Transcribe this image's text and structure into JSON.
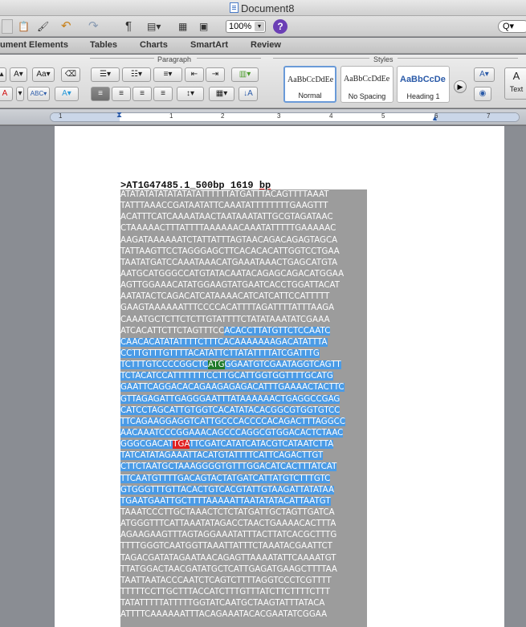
{
  "window": {
    "title": "Document8"
  },
  "toolbar": {
    "zoom_value": "100%",
    "help_label": "?",
    "search_placeholder": "Q▾"
  },
  "ribbon_tabs": [
    "ument Elements",
    "Tables",
    "Charts",
    "SmartArt",
    "Review"
  ],
  "ribbon_groups": {
    "paragraph": "Paragraph",
    "styles": "Styles"
  },
  "styles_gallery": [
    {
      "sample": "AaBbCcDdEe",
      "name": "Normal",
      "active": true
    },
    {
      "sample": "AaBbCcDdEe",
      "name": "No Spacing",
      "active": false
    },
    {
      "sample": "AaBbCcDe",
      "name": "Heading 1",
      "active": false
    }
  ],
  "text_box_label": "Text",
  "ruler_numbers": [
    "1",
    "1",
    "2",
    "3",
    "4",
    "5",
    "6",
    "7"
  ],
  "document": {
    "header_prefix": ">AT1G47485.1_500bp 1619 ",
    "header_bp": "bp",
    "lines": [
      [
        "ATATATATATATATATATTTTTTATGATTTACAGTTTTAAAT"
      ],
      [
        "TATTTAAACCGATAATATTCAAATATTTTTTTTGAAGTTT"
      ],
      [
        "ACATTTCATCAAAATAACTAATAAATATTGCGTAGATAAC"
      ],
      [
        "CTAAAAACTTTATTTTAAAAAACAAATATTTTTGAAAAAC"
      ],
      [
        "AAGATAAAAAATCTATTATTTAGTAACAGACAGAGTAGCA"
      ],
      [
        "TATTAAGTTCCTAGGGAGCTTCACACACATTGGTCCTGAA"
      ],
      [
        "TAATATGATCCAAATAAACATGAAATAAACTGAGCATGTA"
      ],
      [
        "AATGCATGGGCCATGTATACAATACAGAGCAGACATGGAA"
      ],
      [
        "AGTTGGAAACATATGGAAGTATGAATCACCTGGATTACAT"
      ],
      [
        "AATATACTCAGACATCATAAAACATCATCATTCCATTTTT"
      ],
      [
        "GAAGTAAAAAATTTCCCCACATTTTAGATTTTATTTAAGA"
      ],
      [
        "CAAATGCTCTTCTCTTGTATTTTCTATATAAATATCGAAA"
      ],
      [
        "ATCACATTCTTCTAGTTTCC",
        "sel:ACACCTTATGTTCTCCAATC"
      ],
      [
        "sel:CAACACATATATTTTCTTTCACAAAAAAAGACATATTTA"
      ],
      [
        "sel:CCTTGTTTGTTTTACATATTCTTATATTTTATCGATTTG"
      ],
      [
        "sel:TCTTTGTCCCCGGCTC",
        "atg:ATG",
        "sel:GGAATGTCGAATAGGTCAGTT"
      ],
      [
        "sel:TCTACATCCATTTTTTTCCTTGCATTGGTGGTTTTGCATG"
      ],
      [
        "sel:GAATTCAGGACACAGAAGAGAGACATTTGAAAACTACTTC"
      ],
      [
        "sel:GTTAGAGATTGAGGGAATTTATAAAAAACTGAGGCCGAG"
      ],
      [
        "sel:CATCCTAGCATTGTGGTCACATATACACGGCGTGGTGTCC"
      ],
      [
        "sel:TTCAGAAGGAGGTCATTGCCCACCCCACAGACTTTAGGCC"
      ],
      [
        "sel:AACAAATCCCGGAAACAGCCCAGGCGTGGACACTCTAAC"
      ],
      [
        "sel:GGGCGACAT",
        "tga:TGA",
        "sel:TTCGATCATATCATACGTCATAATCTTA"
      ],
      [
        "sel:TATCATATAGAAATTACATGTATTTTCATTCAGACTTGT"
      ],
      [
        "sel:CTTCTAATGCTAAAGGGGTGTTTGGACATCACTTTATCAT"
      ],
      [
        "sel:TTCAATGTTTTGACAGTACTATGATCATTATGTCTTTGTC"
      ],
      [
        "sel:GTGGGTTTGTTACACTGTCACGTATTGTAAGATTATATAA"
      ],
      [
        "sel:TGAATGAATTGCTTTTAAAAATTAATATATACATTAATGT"
      ],
      [
        "TAAATCCCTTGCTAAACTCTCTATGATTGCTAGTTGATCA"
      ],
      [
        "ATGGGTTTCATTAAATATAGACCTAACTGAAAACACTTTA"
      ],
      [
        "AGAAGAAGTTTAGTAGGAAATATTTACTTATCACGCTTTG"
      ],
      [
        "TTTTGGGTCAATGGTTAAATTATTTCTAAATACGAATTCT"
      ],
      [
        "TAGACGATATAGAATAACAGAGTTAAAATATTCAAAATGT"
      ],
      [
        "TTATGGACTAACGATATGCTCATTGAGATGAAGCTTTTAA"
      ],
      [
        "TAATTAATACCCAATCTCAGTCTTTTAGGTCCCTCGTTTT"
      ],
      [
        "TTTTTCCTTGCTTTACCATCTTTGTTTATCTTCTTTTCTTT"
      ],
      [
        "TATATTTTTATTTTTGGTATCAATGCTAAGTATTTATACA"
      ],
      [
        "ATTTTCAAAAAATTTACAGAAATACACGAATATCGGAA"
      ]
    ]
  }
}
